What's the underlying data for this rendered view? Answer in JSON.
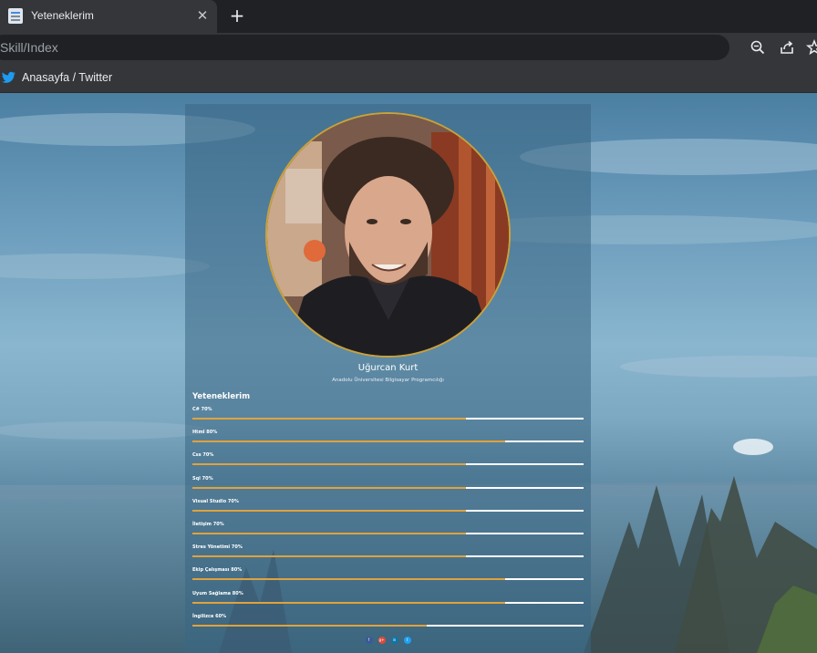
{
  "browser": {
    "tab_title": "Yeteneklerim",
    "tab_close": "✕",
    "new_tab": "+",
    "address": "Skill/Index",
    "bookmark_label": "Anasayfa / Twitter"
  },
  "profile": {
    "name": "Uğurcan Kurt",
    "subtitle": "Anadolu Üniversitesi Bilgisayar Programcılığı",
    "skills_heading": "Yeteneklerim",
    "accent_color": "#e0a23c"
  },
  "skills": [
    {
      "label": "C# 70%",
      "percent": 70
    },
    {
      "label": "Html 80%",
      "percent": 80
    },
    {
      "label": "Css 70%",
      "percent": 70
    },
    {
      "label": "Sql 70%",
      "percent": 70
    },
    {
      "label": "Visual Studio 70%",
      "percent": 70
    },
    {
      "label": "İletişim 70%",
      "percent": 70
    },
    {
      "label": "Stres Yönetimi 70%",
      "percent": 70
    },
    {
      "label": "Ekip Çalışması 80%",
      "percent": 80
    },
    {
      "label": "Uyum Sağlama 80%",
      "percent": 80
    },
    {
      "label": "İngilizce 60%",
      "percent": 60
    }
  ],
  "socials": [
    {
      "icon": "facebook-icon",
      "glyph": "f",
      "color": "#3b5998"
    },
    {
      "icon": "google-plus-icon",
      "glyph": "g+",
      "color": "#dd4b39"
    },
    {
      "icon": "linkedin-icon",
      "glyph": "in",
      "color": "#0e76a8"
    },
    {
      "icon": "twitter-icon",
      "glyph": "t",
      "color": "#1da1f2"
    }
  ]
}
